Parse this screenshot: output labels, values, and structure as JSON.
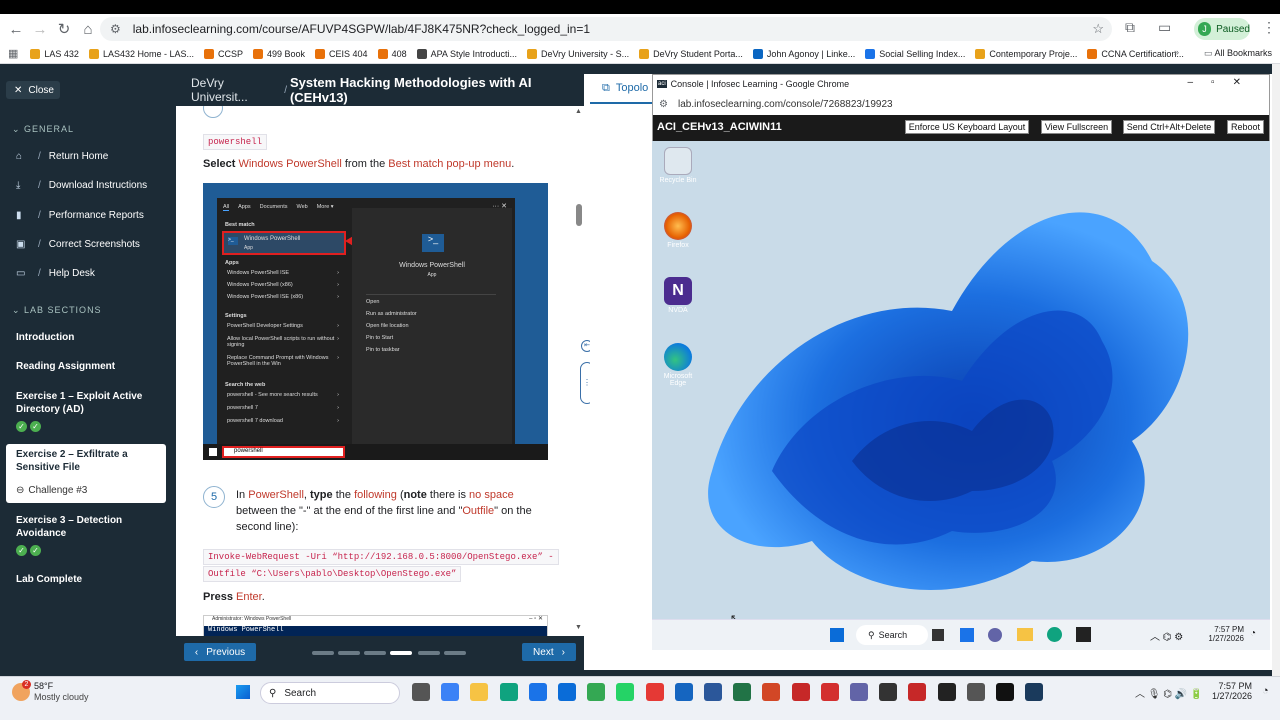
{
  "browser": {
    "url": "lab.infoseclearning.com/course/AFUVP4SGPW/lab/4FJ8K475NR?check_logged_in=1",
    "profile_initial": "J",
    "profile_status": "Paused",
    "bookmarks": [
      "LAS 432",
      "LAS432 Home - LAS...",
      "CCSP",
      "499 Book",
      "CEIS 404",
      "408",
      "APA Style Introducti...",
      "DeVry University - S...",
      "DeVry Student Porta...",
      "John Agonoy | Linke...",
      "Social Selling Index...",
      "Contemporary Proje...",
      "CCNA Certification..."
    ],
    "bookmark_colors": [
      "#e8a21a",
      "#e8a21a",
      "#e8710a",
      "#e8710a",
      "#e8710a",
      "#e8710a",
      "#444",
      "#e8a21a",
      "#e8a21a",
      "#0a66c2",
      "#1a73e8",
      "#e8a21a",
      "#e8710a"
    ],
    "all_bookmarks": "All Bookmarks"
  },
  "sidebar": {
    "close": "Close",
    "general_heading": "GENERAL",
    "general_items": [
      {
        "label": "Return Home",
        "icon": "home-icon"
      },
      {
        "label": "Download Instructions",
        "icon": "download-icon"
      },
      {
        "label": "Performance Reports",
        "icon": "chart-icon"
      },
      {
        "label": "Correct Screenshots",
        "icon": "image-icon"
      },
      {
        "label": "Help Desk",
        "icon": "chat-icon"
      }
    ],
    "lab_heading": "LAB SECTIONS",
    "lab_items": [
      {
        "label": "Introduction"
      },
      {
        "label": "Reading Assignment"
      },
      {
        "label": "Exercise 1 – Exploit Active Directory (AD)"
      },
      {
        "label": "Exercise 2 – Exfiltrate a Sensitive File",
        "sub": "Challenge #3"
      },
      {
        "label": "Exercise 3 – Detection Avoidance"
      },
      {
        "label": "Lab Complete"
      }
    ]
  },
  "content": {
    "breadcrumb": "DeVry Universit...",
    "title": "System Hacking Methodologies with AI (CEHv13)",
    "code1": "powershell",
    "select_text": {
      "a": "Select",
      "b": "Windows PowerShell",
      "c": "from the",
      "d": "Best match pop-up menu",
      "e": "."
    },
    "startmenu": {
      "tabs": [
        "All",
        "Apps",
        "Documents",
        "Web",
        "More ▾"
      ],
      "best_match": "Best match",
      "best_item": "Windows PowerShell",
      "best_sub": "App",
      "apps_h": "Apps",
      "apps": [
        "Windows PowerShell ISE",
        "Windows PowerShell (x86)",
        "Windows PowerShell ISE (x86)"
      ],
      "settings_h": "Settings",
      "settings": [
        "PowerShell Developer Settings",
        "Allow local PowerShell scripts to run without signing",
        "Replace Command Prompt with Windows PowerShell in the Win"
      ],
      "web_h": "Search the web",
      "web": [
        "powershell - See more search results",
        "powershell 7",
        "powershell 7 download"
      ],
      "right_title": "Windows PowerShell",
      "right_sub": "App",
      "actions": [
        "Open",
        "Run as administrator",
        "Open file location",
        "Pin to Start",
        "Pin to taskbar"
      ],
      "search_text": "powershell"
    },
    "step_num": "5",
    "step_text": {
      "a": "In",
      "b": "PowerShell",
      "c": ", ",
      "d": "type",
      "e": "the",
      "f": "following",
      "g": "(",
      "h": "note",
      "i": "there is",
      "j": "no space",
      "k": "between the \"-\" at the end of the first line and \"",
      "l": "Outfile",
      "m": "\" on the second line):"
    },
    "code2": "Invoke-WebRequest -Uri “http://192.168.0.5:8000/OpenStego.exe” -",
    "code3": "Outfile “C:\\Users\\pablo\\Desktop\\OpenStego.exe”",
    "press": "Press",
    "enter": "Enter",
    "dot_end": ".",
    "ps_title": "Administrator: Windows PowerShell",
    "ps_line": "Windows PowerShell",
    "prev": "Previous",
    "next": "Next"
  },
  "right": {
    "tab": "Topolo",
    "console_title": "Console | Infosec Learning - Google Chrome",
    "console_url": "lab.infoseclearning.com/console/7268823/19923",
    "vm_name": "ACI_CEHv13_ACIWIN11",
    "buttons": [
      "Enforce US Keyboard Layout",
      "View Fullscreen",
      "Send Ctrl+Alt+Delete",
      "Reboot"
    ],
    "desktop_icons": [
      "Recycle Bin",
      "Firefox",
      "NVDA",
      "Microsoft Edge"
    ],
    "vm_search": "Search",
    "vm_time": "7:57 PM",
    "vm_date": "1/27/2026"
  },
  "taskbar": {
    "temp": "58°F",
    "weather": "Mostly cloudy",
    "badge": "2",
    "search": "Search",
    "time": "7:57 PM",
    "date": "1/27/2026"
  }
}
